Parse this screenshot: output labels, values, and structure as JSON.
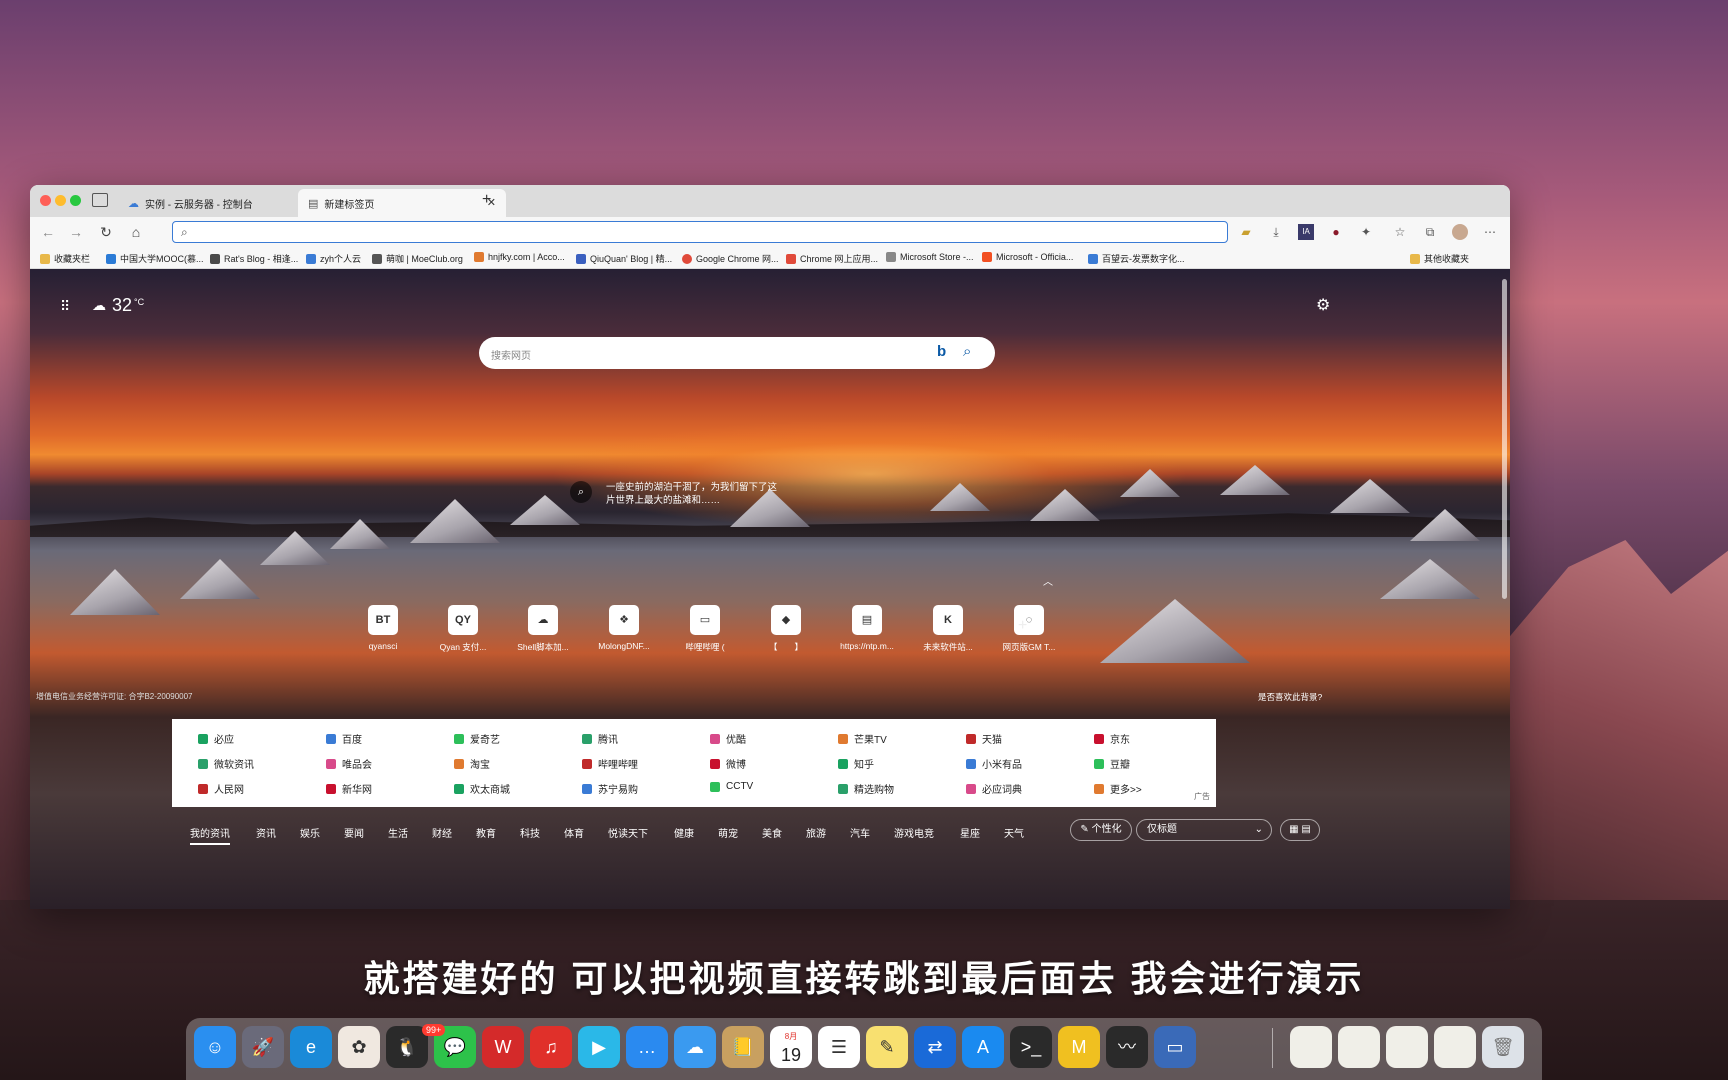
{
  "browser": {
    "tabs": [
      {
        "title": "实例 - 云服务器 - 控制台",
        "icon": "cloud-icon"
      },
      {
        "title": "新建标签页",
        "icon": "new-tab-page-icon"
      }
    ],
    "address": ""
  },
  "bookmarks": [
    {
      "label": "收藏夹栏",
      "color": "#e8b84a"
    },
    {
      "label": "中国大学MOOC(慕...",
      "color": "#2b7bd6"
    },
    {
      "label": "Rat's Blog - 相逢...",
      "color": "#4a4a4a"
    },
    {
      "label": "zyh个人云",
      "color": "#3a7bd5"
    },
    {
      "label": "萌咖 | MoeClub.org",
      "color": "#555555"
    },
    {
      "label": "hnjfky.com | Acco...",
      "color": "#e07a30"
    },
    {
      "label": "QiuQuan' Blog | 精...",
      "color": "#3a5fbf"
    },
    {
      "label": "Google Chrome 网...",
      "color": "#e04a3a"
    },
    {
      "label": "Chrome 网上应用...",
      "color": "#e04a3a"
    },
    {
      "label": "Microsoft Store -...",
      "color": "#888888"
    },
    {
      "label": "Microsoft - Officia...",
      "color": "#f25022"
    },
    {
      "label": "百望云-发票数字化...",
      "color": "#3a7bd5"
    },
    {
      "label": "其他收藏夹",
      "color": "#e8b84a"
    }
  ],
  "ntp": {
    "weather": {
      "temp": "32",
      "unit": "°C"
    },
    "search_placeholder": "搜索网页",
    "story": "一座史前的湖泊干涸了，为我们留下了这片世界上最大的盐滩和……",
    "quick_links": [
      {
        "label": "qyansci",
        "tile": "BT"
      },
      {
        "label": "Qyan 支付...",
        "tile": "QY"
      },
      {
        "label": "Shell脚本加...",
        "tile": "☁"
      },
      {
        "label": "MolongDNF...",
        "tile": "❖"
      },
      {
        "label": "哔哩哔哩 (",
        "tile": "▭"
      },
      {
        "label": "【　　】",
        "tile": "◆"
      },
      {
        "label": "https://ntp.m...",
        "tile": "▤"
      },
      {
        "label": "未来软件站...",
        "tile": "K"
      },
      {
        "label": "网页版GM T...",
        "tile": "◌"
      }
    ],
    "icp": "增值电信业务经营许可证: 合字B2-20090007",
    "like_bg": "是否喜欢此背景?",
    "links": [
      [
        "必应",
        "百度",
        "爱奇艺",
        "腾讯",
        "优酷",
        "芒果TV",
        "天猫",
        "京东"
      ],
      [
        "微软资讯",
        "唯品会",
        "淘宝",
        "哔哩哔哩",
        "微博",
        "知乎",
        "小米有品",
        "豆瓣"
      ],
      [
        "人民网",
        "新华网",
        "欢太商城",
        "苏宁易购",
        "CCTV",
        "精选购物",
        "必应词典",
        "更多>>"
      ]
    ],
    "ad_label": "广告",
    "feed_tabs": [
      "我的资讯",
      "资讯",
      "娱乐",
      "要闻",
      "生活",
      "财经",
      "教育",
      "科技",
      "体育",
      "悦读天下",
      "健康",
      "萌宠",
      "美食",
      "旅游",
      "汽车",
      "游戏电竞",
      "星座",
      "天气"
    ],
    "personalize": "个性化",
    "view_mode": "仅标题"
  },
  "subtitle": "就搭建好的 可以把视频直接转跳到最后面去 我会进行演示",
  "dock": {
    "apps": [
      "finder-icon",
      "launchpad-icon",
      "edge-icon",
      "photos-icon",
      "qq-icon",
      "wechat-icon",
      "wps-icon",
      "netease-music-icon",
      "infuse-icon",
      "messages-icon",
      "baidu-netdisk-icon",
      "contacts-icon",
      "calendar-icon",
      "reminders-icon",
      "notes-icon",
      "teamviewer-icon",
      "app-store-icon",
      "terminal-icon",
      "meituan-icon",
      "activity-monitor-icon",
      "system-info-icon"
    ],
    "qq_badge": "99+",
    "calendar_day": "19",
    "calendar_month": "8月"
  }
}
